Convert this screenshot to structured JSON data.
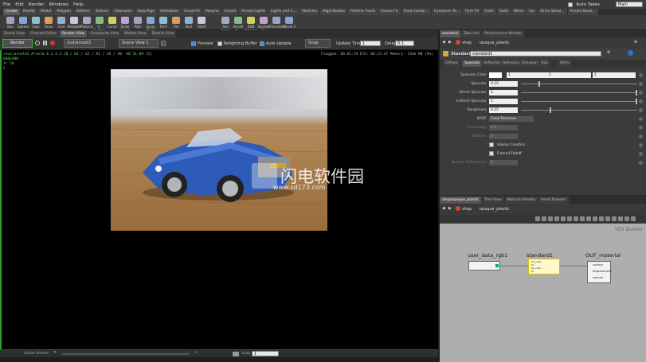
{
  "menu": {
    "items": [
      "File",
      "Edit",
      "Render",
      "Windows",
      "Help"
    ],
    "auto_takes": "Auto Takes",
    "desktop": "Main"
  },
  "shelf_tabs": [
    "Create",
    "Modify",
    "Model",
    "Polygon",
    "Deform",
    "Texture",
    "Character",
    "Auto Rigs",
    "Animation",
    "Cloud FX",
    "Volume",
    "Arnold",
    "Arnold Lights",
    "Lights and C...",
    "Particles",
    "Rigid Bodies",
    "Particle Fluids",
    "Ocean FX",
    "Fluid Contai...",
    "Container To...",
    "Pyro FX",
    "Cloth",
    "Solid",
    "Wires",
    "Fur",
    "Drive Simul...",
    "Arnold Deve..."
  ],
  "shelf_tools": [
    "Box",
    "Sphere",
    "Tube",
    "Torus",
    "Grid",
    "Metaball",
    "Platonic",
    "L-System",
    "Curve",
    "Draw Curve",
    "Path",
    "Spray Paint",
    "Font",
    "File",
    "Null",
    "Shelf",
    "Add Arnol",
    "Arnold R...",
    "RDB Volume",
    "Volume Cu",
    "Procedural",
    "Arnold V"
  ],
  "panel_tabs": [
    "Scene View",
    "Channel Editor",
    "Render View",
    "Composite View",
    "Motion View",
    "Details View"
  ],
  "render_bar": {
    "render_btn": "Render",
    "rop": "/out/arnold1",
    "camera": "Scene View 1",
    "preview": "Preview",
    "relighting": "Relighting Buffer",
    "auto_update": "Auto-Update",
    "snap": "Snap",
    "update_time": "Update Time",
    "update_time_value": "1",
    "delay": "Delay",
    "delay_value": "0.1"
  },
  "hud": {
    "line1": "/out/arnold1   Arnold 4.1.3.3   C8 / D1 / G2 / R1 / S6 / V0 -40 51-09 [1]",
    "line2": "640x480",
    "line3": "fr 59",
    "line4": "C",
    "stats": "Flagged: 00:01:19   ETA: 00:12:47   Memory: 134k MB  (9%)"
  },
  "status": {
    "label": "Active Render",
    "snap": "Snap",
    "snap_value": "1"
  },
  "watermark": {
    "cn": "闪电软件园",
    "url": "www.sd173.com"
  },
  "params_tabs": [
    "standard",
    "Take List",
    "Performance Monitor"
  ],
  "params_path": {
    "obj": "shop",
    "node": "opaque_plastic"
  },
  "node_header": {
    "type": "Standard",
    "name": "standard1"
  },
  "param_subtabs": [
    "Diffuse",
    "Specular",
    "Reflection",
    "Refraction",
    "Emission",
    "SSS",
    "AOVs"
  ],
  "params": [
    {
      "label": "Specular Color",
      "value": "1",
      "v2": "1",
      "v3": "1"
    },
    {
      "label": "Specular",
      "value": "0.15",
      "s": 0.15
    },
    {
      "label": "Direct Specular",
      "value": "1",
      "s": 1
    },
    {
      "label": "Indirect Specular",
      "value": "1",
      "s": 1
    },
    {
      "label": "Roughness",
      "value": "0.25",
      "s": 0.25
    },
    {
      "label": "BRDF",
      "value": "Cook-Torrance"
    },
    {
      "label": "Anisotropy",
      "value": "0.5"
    },
    {
      "label": "Rotation",
      "value": "0"
    },
    {
      "label": "",
      "value": "Glossy Caustics"
    },
    {
      "label": "",
      "value": "Fresnel Falloff"
    },
    {
      "label": "Normal Reflectance",
      "value": "0"
    }
  ],
  "network_tabs": [
    "shop/opaque_plastic",
    "Tree View",
    "Material Palette",
    "Asset Browser"
  ],
  "network_path": {
    "obj": "shop",
    "node": "opaque_plastic"
  },
  "network": {
    "context": "VEX Builder",
    "nodes": [
      {
        "name": "user_data_rgb1"
      },
      {
        "name": "standard1"
      },
      {
        "name": "OUT_material"
      }
    ],
    "ports": {
      "standard": [
        "Kd_color",
        "Ks",
        "Ks_color",
        "Kr",
        "Kt",
        "opacity"
      ],
      "out": [
        "surface",
        "displacement",
        "volume"
      ]
    }
  }
}
